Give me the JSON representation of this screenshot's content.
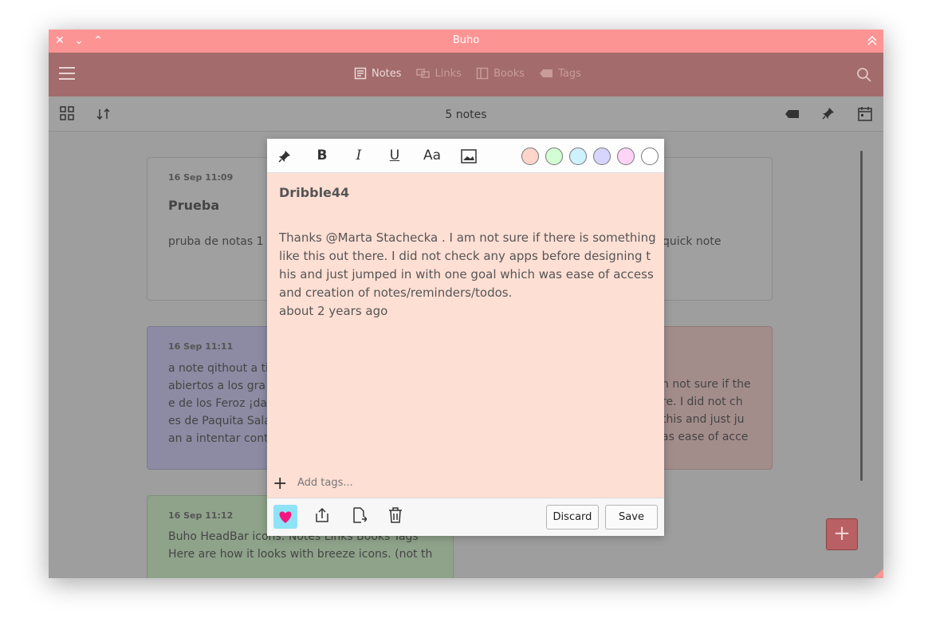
{
  "window": {
    "title": "Buho"
  },
  "headbar": {
    "nav": [
      {
        "label": "Notes",
        "icon": "notes-icon",
        "active": true
      },
      {
        "label": "Links",
        "icon": "links-icon",
        "active": false
      },
      {
        "label": "Books",
        "icon": "books-icon",
        "active": false
      },
      {
        "label": "Tags",
        "icon": "tags-icon",
        "active": false
      }
    ]
  },
  "toolbar": {
    "count": "5 notes"
  },
  "notes": [
    {
      "date": "16 Sep 11:09",
      "title": "Prueba",
      "body": "pruba de notas 1",
      "color": "#a0a0a0"
    },
    {
      "date": "",
      "title": "",
      "body": "quick note",
      "color": "#a0a0a0"
    },
    {
      "date": "16 Sep 11:11",
      "title": "",
      "body": "a note qithout a ti\nabiertos a los gra\ne de los Feroz ¡da\nes de Paquita Sala\nan a intentar cont",
      "color": "#8c8ba3"
    },
    {
      "date": "",
      "title": "",
      "body": "n not sure if the\nre. I did not ch\nthis and just ju\nas ease of acce",
      "color": "#a38d8b"
    },
    {
      "date": "16 Sep 11:12",
      "title": "",
      "body": "Buho HeadBar icons: Notes Links Books Tags\nHere are how it looks with breeze icons. (not th",
      "color": "#8fa38b"
    }
  ],
  "editor": {
    "title": "Dribble44",
    "body": "Thanks @Marta Stachecka . I am not sure if there is something\nlike this out there. I did not check any apps before designing t\nhis and just jumped in with one goal which was ease of access\nand creation of notes/reminders/todos.\nabout 2 years ago",
    "tags_placeholder": "Add tags...",
    "bold": "B",
    "italic": "I",
    "underline": "U",
    "font": "Aa",
    "swatches": [
      "#fed4cb",
      "#d3fdd3",
      "#cdf1fd",
      "#d7d5fe",
      "#fed3f5",
      "#ffffff"
    ],
    "background": "#fedfd4",
    "discard_label": "Discard",
    "save_label": "Save"
  },
  "colors": {
    "titlebar": "#fc9494",
    "headbar": "#a36b6b",
    "favorite_accent": "#8fe3f7",
    "heart": "#f7157f"
  }
}
